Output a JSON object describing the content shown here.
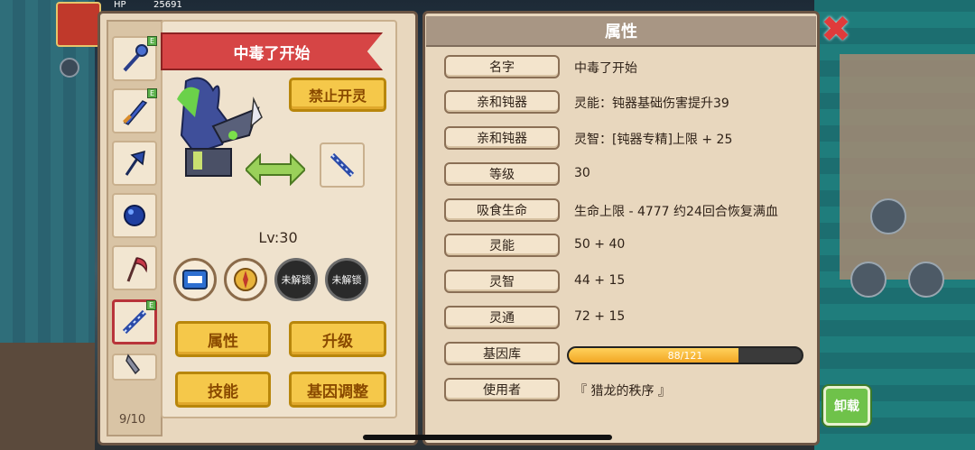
{
  "hud": {
    "hp_label": "HP",
    "hp_value": "25691"
  },
  "inventory": {
    "page": "9/10",
    "slots": [
      {
        "icon": "mace-icon",
        "badge": "E"
      },
      {
        "icon": "sword-icon",
        "badge": "E"
      },
      {
        "icon": "axe-icon",
        "badge": ""
      },
      {
        "icon": "orb-icon",
        "badge": ""
      },
      {
        "icon": "scythe-icon",
        "badge": ""
      },
      {
        "icon": "staff-icon",
        "badge": "E",
        "selected": true
      },
      {
        "icon": "blade-icon",
        "badge": ""
      }
    ]
  },
  "pet": {
    "name": "中毒了开始",
    "forbid_button": "禁止开灵",
    "level": "Lv:30",
    "unlock1": "未解锁",
    "unlock2": "未解锁",
    "buttons": {
      "attributes": "属性",
      "upgrade": "升级",
      "skills": "技能",
      "gene_adjust": "基因调整"
    }
  },
  "attributes": {
    "title": "属性",
    "rows": [
      {
        "label": "名字",
        "value": "中毒了开始"
      },
      {
        "label": "亲和钝器",
        "value": "灵能：钝器基础伤害提升39"
      },
      {
        "label": "亲和钝器",
        "value": "灵智：[钝器专精]上限 + 25"
      },
      {
        "label": "等级",
        "value": "30"
      },
      {
        "label": "吸食生命",
        "value": "生命上限 - 4777  约24回合恢复满血"
      },
      {
        "label": "灵能",
        "value": "50 + 40"
      },
      {
        "label": "灵智",
        "value": "44 + 15"
      },
      {
        "label": "灵通",
        "value": "72 + 15"
      },
      {
        "label": "基因库",
        "value": "88/121"
      },
      {
        "label": "使用者",
        "value": "『 猎龙的秩序 』"
      }
    ],
    "gene_progress": 0.727
  },
  "unequip_button": "卸载",
  "close_icon": "close-icon"
}
